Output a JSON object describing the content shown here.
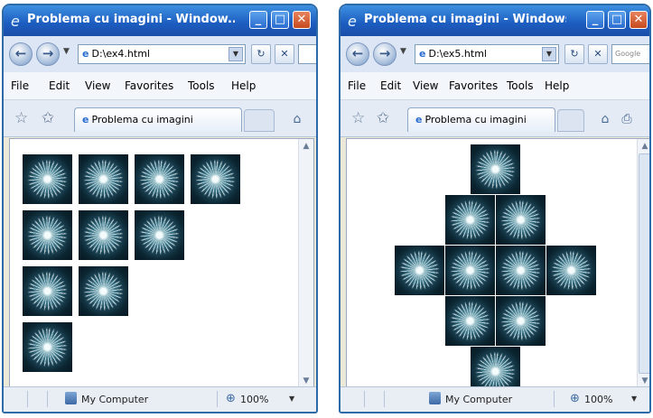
{
  "windows": [
    {
      "title": "Problema cu imagini - Window...",
      "address": "D:\\ex4.html",
      "search": "",
      "menu": [
        "File",
        "Edit",
        "View",
        "Favorites",
        "Tools",
        "Help"
      ],
      "tab_label": "Problema cu imagini",
      "status_zone": "My Computer",
      "zoom": "100%",
      "layout": "staircase",
      "image_rows": [
        4,
        3,
        2,
        1
      ]
    },
    {
      "title": "Problema cu imagini - Windows Inter...",
      "address": "D:\\ex5.html",
      "search": "Google",
      "menu": [
        "File",
        "Edit",
        "View",
        "Favorites",
        "Tools",
        "Help"
      ],
      "tab_label": "Problema cu imagini",
      "status_zone": "My Computer",
      "zoom": "100%",
      "layout": "diamond",
      "image_rows": [
        1,
        2,
        4,
        2,
        1
      ]
    }
  ],
  "icons": {
    "ie": "ie-logo-icon",
    "back": "back-arrow-icon",
    "forward": "forward-arrow-icon",
    "refresh": "refresh-icon",
    "stop": "stop-icon",
    "favorites": "favorites-star-icon",
    "add_favorites": "add-favorites-icon",
    "computer": "my-computer-icon",
    "zoom": "zoom-magnifier-icon",
    "flower_image": "flower-image"
  },
  "colors": {
    "titlebar": "#1c5cc0",
    "image_background": "#05161f",
    "image_petals": "#e1f0f4"
  }
}
